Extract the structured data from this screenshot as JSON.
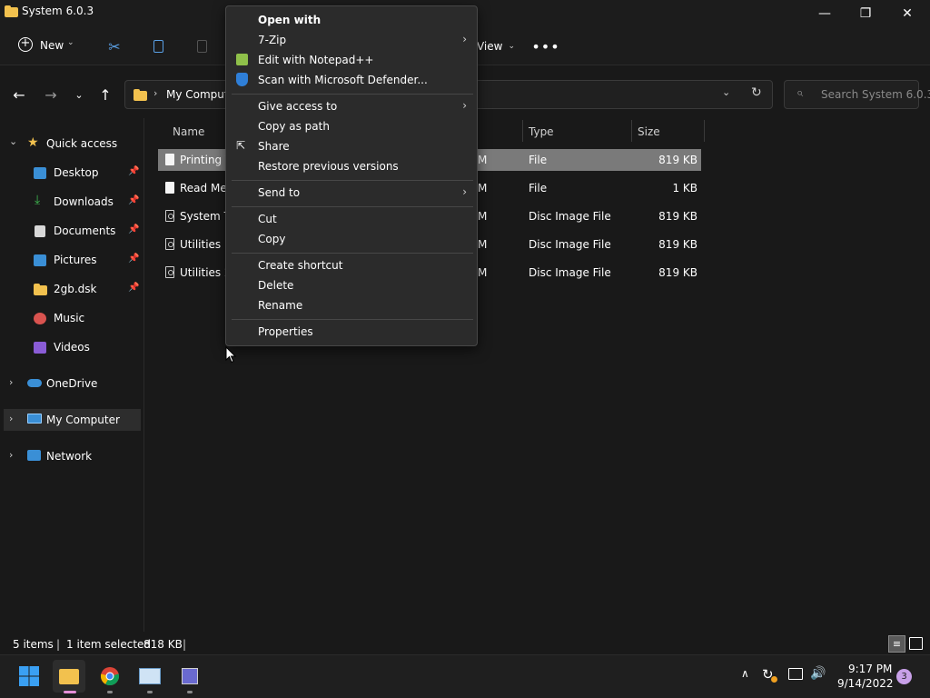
{
  "window": {
    "title": "System 6.0.3",
    "minimize": "—",
    "restore": "❐",
    "close": "✕"
  },
  "toolbar": {
    "new_label": "New",
    "view_label": "View"
  },
  "address": {
    "path_root": "My Computer",
    "search_placeholder": "Search System 6.0.3"
  },
  "nav": {
    "quick_access": "Quick access",
    "items": [
      {
        "label": "Desktop",
        "pinned": true
      },
      {
        "label": "Downloads",
        "pinned": true
      },
      {
        "label": "Documents",
        "pinned": true
      },
      {
        "label": "Pictures",
        "pinned": true
      },
      {
        "label": "2gb.dsk",
        "pinned": true
      },
      {
        "label": "Music",
        "pinned": false
      },
      {
        "label": "Videos",
        "pinned": false
      }
    ],
    "onedrive": "OneDrive",
    "my_computer": "My Computer",
    "network": "Network"
  },
  "columns": {
    "name": "Name",
    "type": "Type",
    "size": "Size"
  },
  "files": [
    {
      "name": "Printing T",
      "date_frag": "M",
      "type": "File",
      "size": "819 KB",
      "icon": "file",
      "selected": true
    },
    {
      "name": "Read Me",
      "date_frag": "M",
      "type": "File",
      "size": "1 KB",
      "icon": "file",
      "selected": false
    },
    {
      "name": "System To",
      "date_frag": "M",
      "type": "Disc Image File",
      "size": "819 KB",
      "icon": "disc",
      "selected": false
    },
    {
      "name": "Utilities 1.",
      "date_frag": "M",
      "type": "Disc Image File",
      "size": "819 KB",
      "icon": "disc",
      "selected": false
    },
    {
      "name": "Utilities 2.",
      "date_frag": "M",
      "type": "Disc Image File",
      "size": "819 KB",
      "icon": "disc",
      "selected": false
    }
  ],
  "context_menu": {
    "open_with": "Open with",
    "seven_zip": "7-Zip",
    "notepadpp": "Edit with Notepad++",
    "defender": "Scan with Microsoft Defender...",
    "give_access": "Give access to",
    "copy_path": "Copy as path",
    "share": "Share",
    "restore": "Restore previous versions",
    "send_to": "Send to",
    "cut": "Cut",
    "copy": "Copy",
    "create_shortcut": "Create shortcut",
    "delete": "Delete",
    "rename": "Rename",
    "properties": "Properties"
  },
  "status": {
    "items": "5 items",
    "selected": "1 item selected",
    "sel_size": "818 KB"
  },
  "taskbar": {
    "time": "9:17 PM",
    "date": "9/14/2022",
    "notif_count": "3"
  },
  "colors": {
    "accent": "#0078d4",
    "folder": "#f2c14e",
    "selection": "#7a7a7a"
  }
}
